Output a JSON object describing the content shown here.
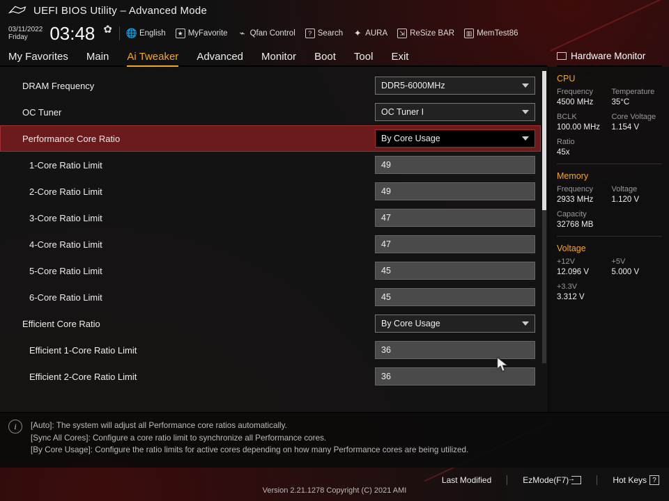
{
  "header": {
    "title": "UEFI BIOS Utility – Advanced Mode",
    "date": "03/11/2022",
    "day": "Friday",
    "time": "03:48",
    "toolbar": {
      "language": "English",
      "myfavorite": "MyFavorite",
      "qfan": "Qfan Control",
      "search": "Search",
      "aura": "AURA",
      "resizebar": "ReSize BAR",
      "memtest": "MemTest86"
    }
  },
  "tabs": [
    "My Favorites",
    "Main",
    "Ai Tweaker",
    "Advanced",
    "Monitor",
    "Boot",
    "Tool",
    "Exit"
  ],
  "active_tab": 2,
  "settings": [
    {
      "label": "DRAM Frequency",
      "type": "dropdown",
      "value": "DDR5-6000MHz",
      "indent": 1
    },
    {
      "label": "OC Tuner",
      "type": "dropdown",
      "value": "OC Tuner I",
      "indent": 1
    },
    {
      "label": "Performance Core Ratio",
      "type": "dropdown",
      "value": "By Core Usage",
      "indent": 1,
      "selected": true
    },
    {
      "label": "1-Core Ratio Limit",
      "type": "number",
      "value": "49",
      "indent": 2
    },
    {
      "label": "2-Core Ratio Limit",
      "type": "number",
      "value": "49",
      "indent": 2
    },
    {
      "label": "3-Core Ratio Limit",
      "type": "number",
      "value": "47",
      "indent": 2
    },
    {
      "label": "4-Core Ratio Limit",
      "type": "number",
      "value": "47",
      "indent": 2
    },
    {
      "label": "5-Core Ratio Limit",
      "type": "number",
      "value": "45",
      "indent": 2
    },
    {
      "label": "6-Core Ratio Limit",
      "type": "number",
      "value": "45",
      "indent": 2
    },
    {
      "label": "Efficient Core Ratio",
      "type": "dropdown",
      "value": "By Core Usage",
      "indent": 1
    },
    {
      "label": "Efficient 1-Core Ratio Limit",
      "type": "number",
      "value": "36",
      "indent": 2
    },
    {
      "label": "Efficient 2-Core Ratio Limit",
      "type": "number",
      "value": "36",
      "indent": 2
    }
  ],
  "help": {
    "l1": "[Auto]: The system will adjust all Performance core ratios automatically.",
    "l2": "[Sync All Cores]: Configure a core ratio limit to synchronize all Performance cores.",
    "l3": "[By Core Usage]: Configure the ratio limits for active cores depending on how many Performance cores are being utilized."
  },
  "hw": {
    "title": "Hardware Monitor",
    "cpu": {
      "title": "CPU",
      "freq_k": "Frequency",
      "freq_v": "4500 MHz",
      "temp_k": "Temperature",
      "temp_v": "35°C",
      "bclk_k": "BCLK",
      "bclk_v": "100.00 MHz",
      "cv_k": "Core Voltage",
      "cv_v": "1.154 V",
      "ratio_k": "Ratio",
      "ratio_v": "45x"
    },
    "mem": {
      "title": "Memory",
      "freq_k": "Frequency",
      "freq_v": "2933 MHz",
      "volt_k": "Voltage",
      "volt_v": "1.120 V",
      "cap_k": "Capacity",
      "cap_v": "32768 MB"
    },
    "volt": {
      "title": "Voltage",
      "v12_k": "+12V",
      "v12_v": "12.096 V",
      "v5_k": "+5V",
      "v5_v": "5.000 V",
      "v33_k": "+3.3V",
      "v33_v": "3.312 V"
    }
  },
  "footer": {
    "lastmod": "Last Modified",
    "ezmode": "EzMode(F7)",
    "hotkeys": "Hot Keys",
    "version": "Version 2.21.1278 Copyright (C) 2021 AMI"
  }
}
